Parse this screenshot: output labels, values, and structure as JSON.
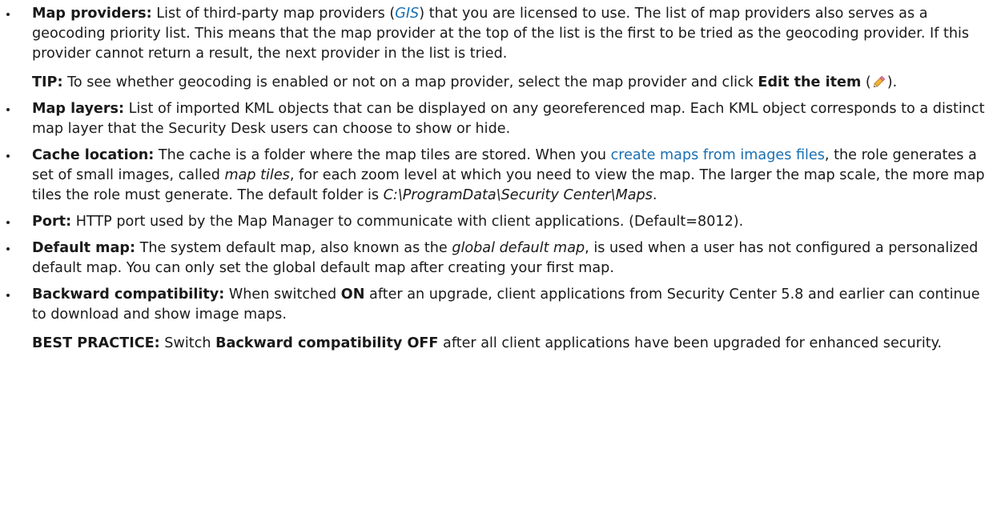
{
  "items": {
    "map_providers": {
      "term": "Map providers:",
      "t1": " List of third-party map providers (",
      "link": "GIS",
      "t2": ") that you are licensed to use. The list of map providers also serves as a geocoding priority list. This means that the map provider at the top of the list is the first to be tried as the geocoding provider. If this provider cannot return a result, the next provider in the list is tried.",
      "tip_label": "TIP:",
      "tip_text": "  To see whether geocoding is enabled or not on a map provider, select the map provider and click ",
      "tip_action": "Edit the item",
      "tip_paren_open": " (",
      "tip_paren_close": ").",
      "icon": "pencil-icon"
    },
    "map_layers": {
      "term": "Map layers:",
      "text": " List of imported KML objects that can be displayed on any georeferenced map. Each KML object corresponds to a distinct map layer that the Security Desk users can choose to show or hide."
    },
    "cache_location": {
      "term": "Cache location:",
      "t1": " The cache is a folder where the map tiles are stored. When you ",
      "link": "create maps from images files",
      "t2": ", the role generates a set of small images, called ",
      "em": "map tiles",
      "t3": ", for each zoom level at which you need to view the map. The larger the map scale, the more map tiles the role must generate. The default folder is ",
      "path": "C:\\ProgramData\\Security Center\\Maps",
      "t4": "."
    },
    "port": {
      "term": "Port:",
      "text": " HTTP port used by the Map Manager to communicate with client applications. (Default=8012)."
    },
    "default_map": {
      "term": "Default map:",
      "t1": " The system default map, also known as the ",
      "em": "global default map",
      "t2": ", is used when a user has not configured a personalized default map. You can only set the global default map after creating your first map."
    },
    "backward_compatibility": {
      "term": "Backward compatibility:",
      "t1": " When switched ",
      "on": "ON",
      "t2": " after an upgrade, client applications from Security Center 5.8 and earlier can continue to download and show image maps.",
      "bp_label": "BEST PRACTICE:",
      "bp_t1": "  Switch ",
      "bp_setting": "Backward compatibility OFF",
      "bp_t2": " after all client applications have been upgraded for enhanced security."
    }
  },
  "colors": {
    "text": "#1a1a1a",
    "link": "#1a6fb0",
    "background": "#ffffff"
  }
}
